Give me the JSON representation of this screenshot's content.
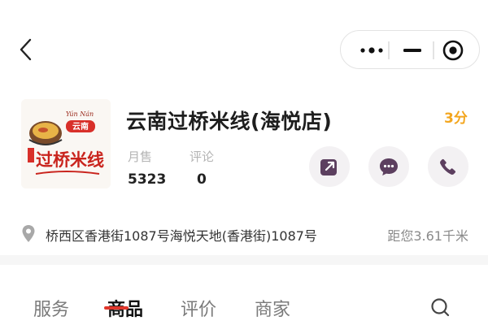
{
  "colors": {
    "accent": "#e0362b",
    "rating": "#f3a61e",
    "muted": "#b4b4b4",
    "action_bg": "#f3f1f3",
    "action_icon": "#5c3f5f"
  },
  "nav": {
    "back_icon": "chevron-left-icon",
    "capsule": [
      "more-dots-icon",
      "minimize-icon",
      "close-target-icon"
    ]
  },
  "store": {
    "logo": {
      "caption_top": "Yún Nán",
      "caption_badge": "云南",
      "caption_main": "过桥米线"
    },
    "name": "云南过桥米线(海悦店)",
    "rating": "3分",
    "sales_label": "月售",
    "sales_value": "5323",
    "reviews_label": "评论",
    "reviews_value": "0",
    "actions": [
      "share-icon",
      "chat-icon",
      "phone-icon"
    ]
  },
  "address": {
    "text": "桥西区香港街1087号海悦天地(香港街)1087号",
    "distance": "距您3.61千米"
  },
  "tabs": [
    {
      "label": "服务"
    },
    {
      "label": "商品",
      "active": true
    },
    {
      "label": "评价"
    },
    {
      "label": "商家"
    }
  ]
}
